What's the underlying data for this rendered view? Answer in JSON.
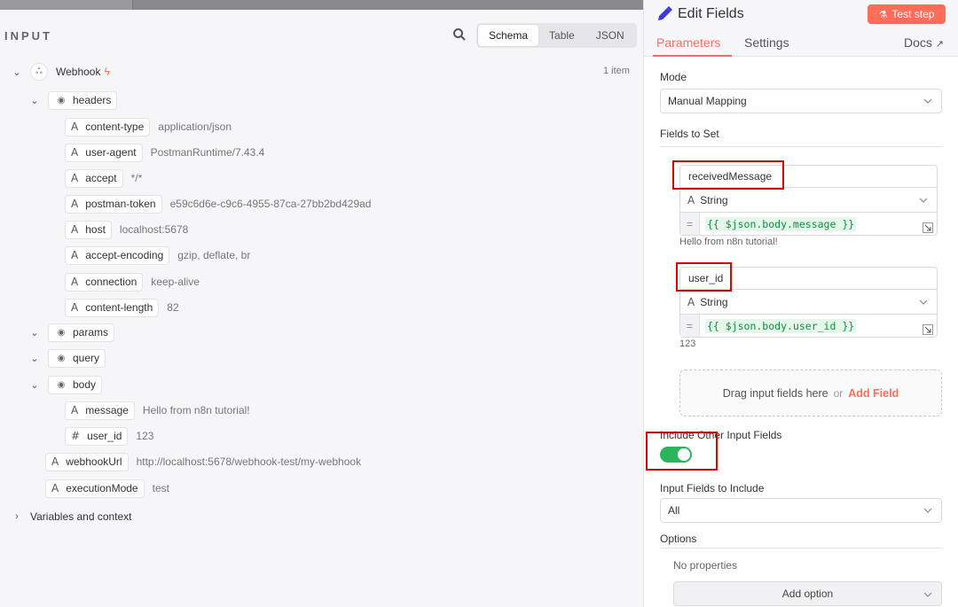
{
  "left": {
    "input_label": "INPUT",
    "view_tabs": [
      "Schema",
      "Table",
      "JSON"
    ],
    "item_count": "1 item",
    "root": {
      "label": "Webhook"
    },
    "headers": {
      "label": "headers",
      "items": [
        {
          "key": "content-type",
          "value": "application/json"
        },
        {
          "key": "user-agent",
          "value": "PostmanRuntime/7.43.4"
        },
        {
          "key": "accept",
          "value": "*/*"
        },
        {
          "key": "postman-token",
          "value": "e59c6d6e-c9c6-4955-87ca-27bb2bd429ad"
        },
        {
          "key": "host",
          "value": "localhost:5678"
        },
        {
          "key": "accept-encoding",
          "value": "gzip, deflate, br"
        },
        {
          "key": "connection",
          "value": "keep-alive"
        },
        {
          "key": "content-length",
          "value": "82"
        }
      ]
    },
    "params_label": "params",
    "query_label": "query",
    "body": {
      "label": "body",
      "items": [
        {
          "type": "A",
          "key": "message",
          "value": "Hello from n8n tutorial!"
        },
        {
          "type": "#",
          "key": "user_id",
          "value": "123"
        }
      ]
    },
    "webhook_url": {
      "key": "webhookUrl",
      "value": "http://localhost:5678/webhook-test/my-webhook"
    },
    "execution_mode": {
      "key": "executionMode",
      "value": "test"
    },
    "variables_label": "Variables and context"
  },
  "right": {
    "title": "Edit Fields",
    "test_step": "Test step",
    "tabs": {
      "parameters": "Parameters",
      "settings": "Settings",
      "docs": "Docs"
    },
    "mode_label": "Mode",
    "mode_value": "Manual Mapping",
    "fields_to_set_label": "Fields to Set",
    "fields": [
      {
        "name": "receivedMessage",
        "type": "String",
        "expr": "{{ $json.body.message }}",
        "preview": "Hello from n8n tutorial!"
      },
      {
        "name": "user_id",
        "type": "String",
        "expr": "{{ $json.body.user_id }}",
        "preview": "123"
      }
    ],
    "dropzone": {
      "text": "Drag input fields here",
      "or": "or",
      "add": "Add Field"
    },
    "include_other_label": "Include Other Input Fields",
    "include_other_on": true,
    "input_fields_to_include_label": "Input Fields to Include",
    "input_fields_to_include_value": "All",
    "options_label": "Options",
    "no_properties": "No properties",
    "add_option": "Add option"
  },
  "colors": {
    "accent": "#ff6d5a",
    "toggle_on": "#2db55d",
    "highlight_box": "#e00000"
  }
}
